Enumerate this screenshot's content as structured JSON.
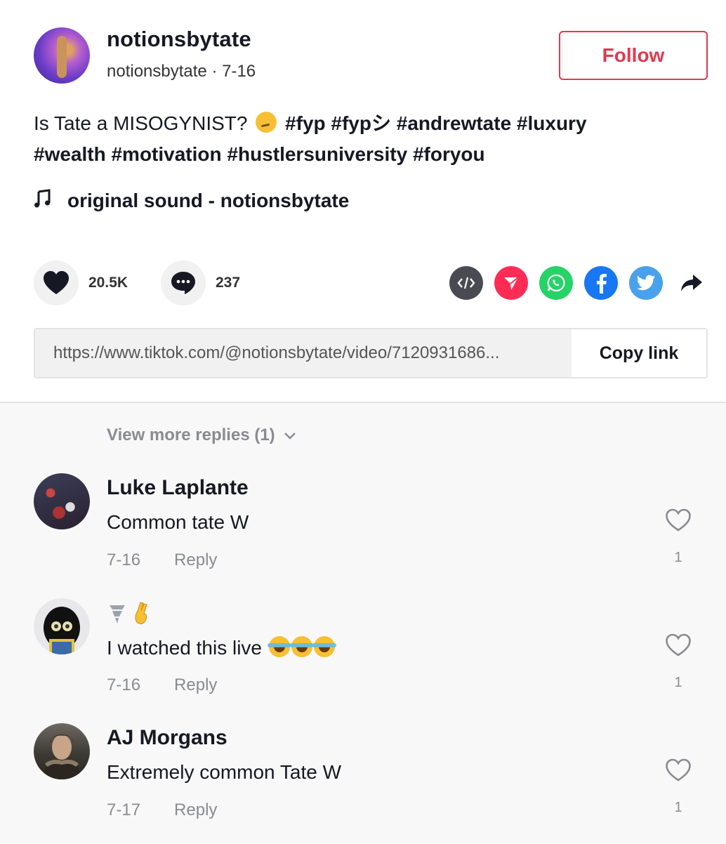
{
  "post": {
    "username": "notionsbytate",
    "handle_date": "notionsbytate · 7-16",
    "follow_label": "Follow",
    "description_prefix": "Is Tate a MISOGYNIST? ",
    "hashtags_line1": "#fyp #fypシ #andrewtate #luxury",
    "hashtags_line2": "#wealth #motivation #hustlersuniversity #foryou",
    "sound": "original sound - notionsbytate",
    "likes": "20.5K",
    "comments": "237",
    "share_url": "https://www.tiktok.com/@notionsbytate/video/7120931686...",
    "copy_link_label": "Copy link"
  },
  "share_icons": [
    "embed-icon",
    "send-to-friends-icon",
    "whatsapp-icon",
    "facebook-icon",
    "twitter-icon",
    "share-arrow-icon"
  ],
  "colors": {
    "follow_red": "#e0394f",
    "embed": "#4a4b52",
    "send": "#fe2c55",
    "whatsapp": "#25d366",
    "facebook": "#1877f2",
    "twitter": "#4aa1eb"
  },
  "comments_section": {
    "view_more": "View more replies (1)",
    "items": [
      {
        "name": "Luke Laplante",
        "text": "Common tate W",
        "date": "7-16",
        "reply": "Reply",
        "likes": "1"
      },
      {
        "name": "",
        "text": "I watched this live ",
        "date": "7-16",
        "reply": "Reply",
        "likes": "1"
      },
      {
        "name": "AJ Morgans",
        "text": "Extremely common Tate W",
        "date": "7-17",
        "reply": "Reply",
        "likes": "1"
      }
    ]
  }
}
